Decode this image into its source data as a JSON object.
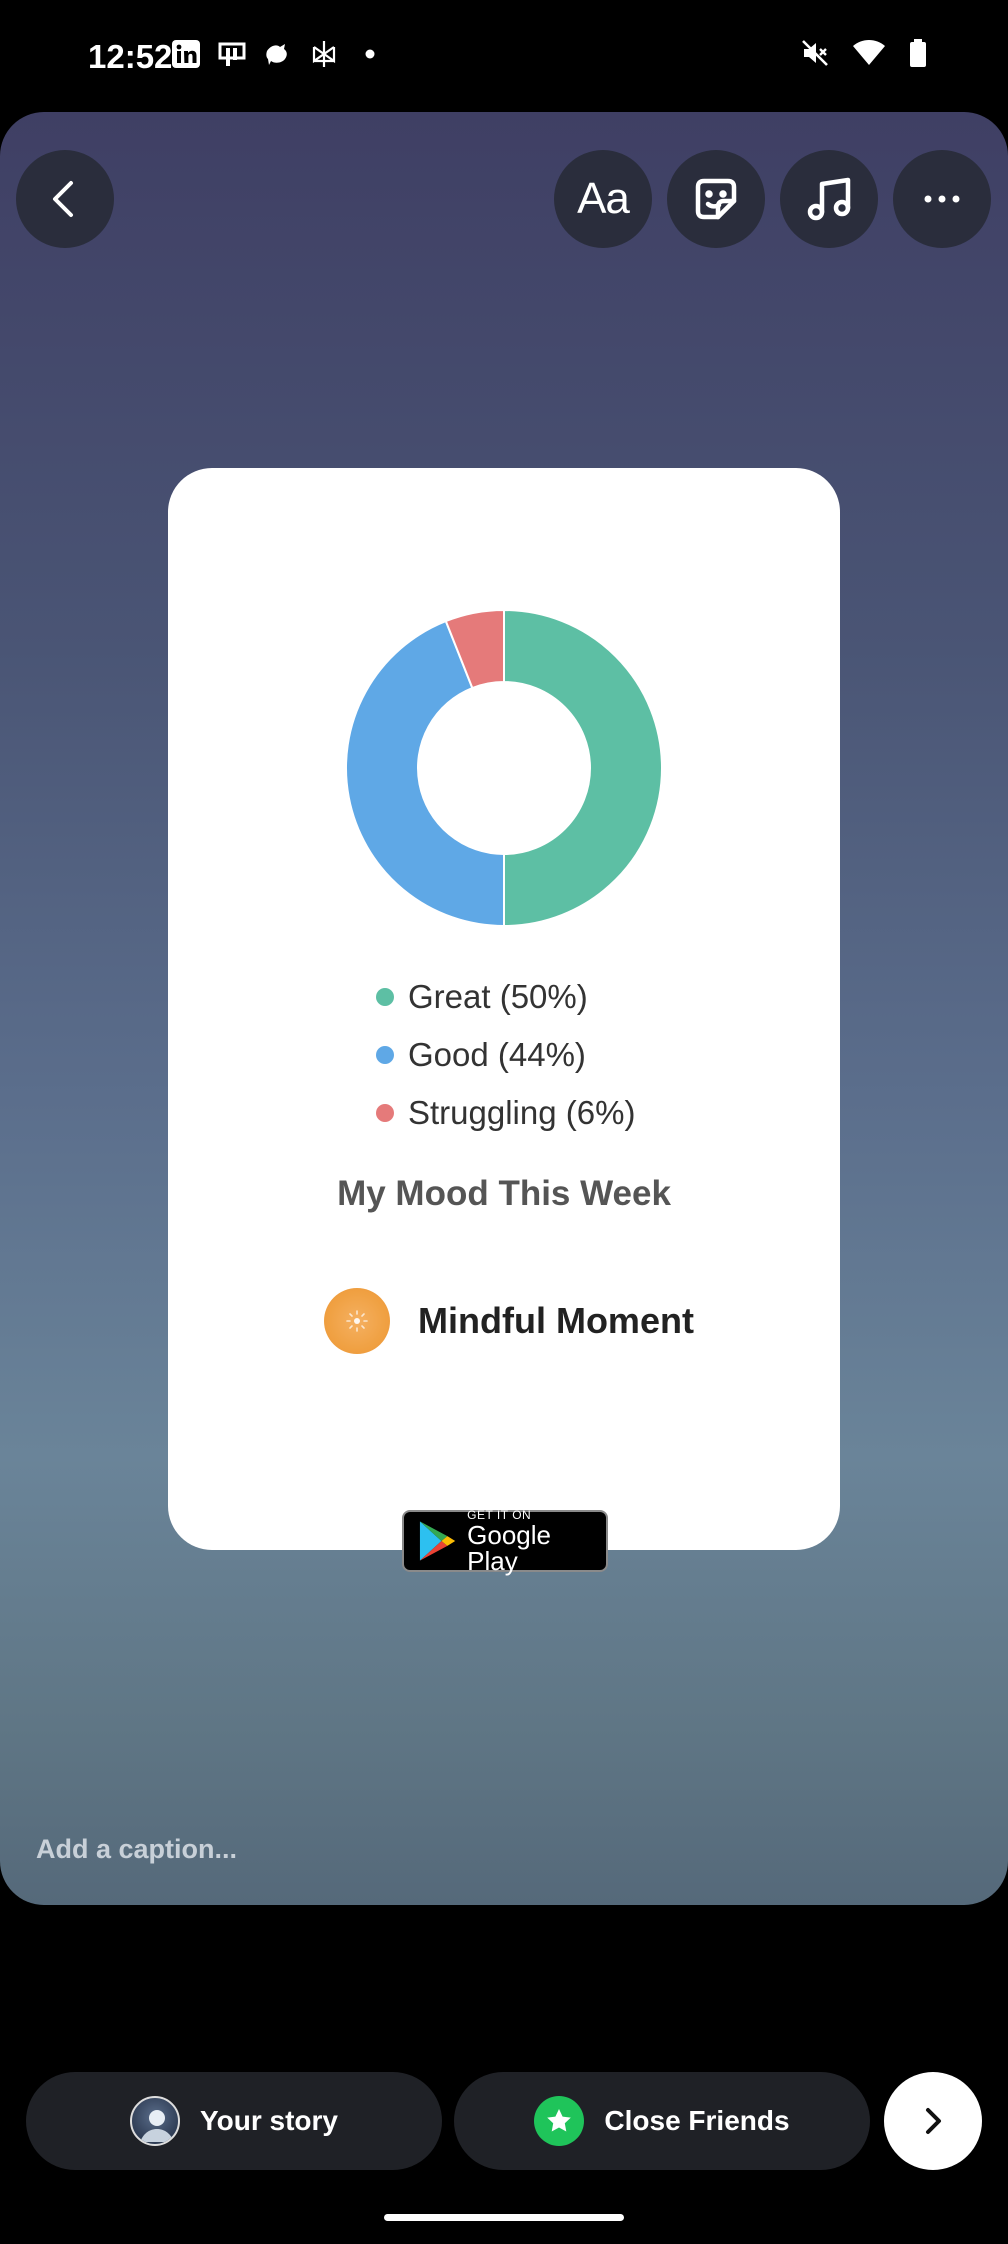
{
  "status_bar": {
    "time": "12:52",
    "left_icons": [
      "linkedin-icon",
      "app-icon",
      "bird-icon",
      "perplexity-icon",
      "dot-icon"
    ],
    "right_icons": [
      "mute-icon",
      "wifi-icon",
      "battery-icon"
    ]
  },
  "toolbar": {
    "text_label": "Aa"
  },
  "card": {
    "chart_data": {
      "type": "pie",
      "categories": [
        "Great",
        "Good",
        "Struggling"
      ],
      "values": [
        50,
        44,
        6
      ],
      "colors": [
        "#5dbfa4",
        "#5fa8e6",
        "#e57a7a"
      ]
    },
    "legend": [
      {
        "label": "Great (50%)",
        "color": "#5dbfa4"
      },
      {
        "label": "Good (44%)",
        "color": "#5fa8e6"
      },
      {
        "label": "Struggling (6%)",
        "color": "#e57a7a"
      }
    ],
    "title": "My Mood This Week",
    "brand_name": "Mindful Moment",
    "gplay_small": "GET IT ON",
    "gplay_big": "Google Play"
  },
  "caption": {
    "placeholder": "Add a caption..."
  },
  "bottom": {
    "your_story": "Your story",
    "close_friends": "Close Friends"
  }
}
